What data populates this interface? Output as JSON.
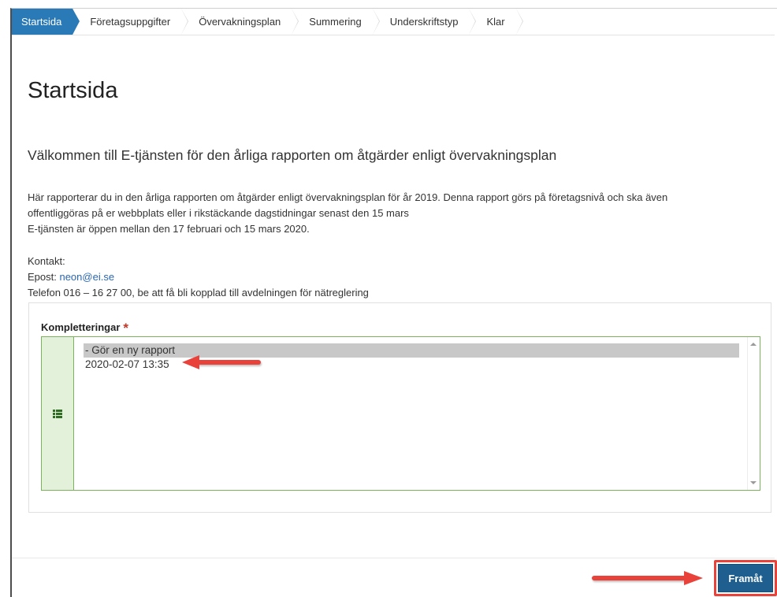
{
  "steps": [
    {
      "label": "Startsida",
      "active": true
    },
    {
      "label": "Företagsuppgifter",
      "active": false
    },
    {
      "label": "Övervakningsplan",
      "active": false
    },
    {
      "label": "Summering",
      "active": false
    },
    {
      "label": "Underskriftstyp",
      "active": false
    },
    {
      "label": "Klar",
      "active": false
    }
  ],
  "page": {
    "title": "Startsida",
    "subtitle": "Välkommen till E-tjänsten för den årliga rapporten om åtgärder enligt övervakningsplan",
    "paragraph_line1": "Här rapporterar du in den årliga rapporten om åtgärder enligt övervakningsplan för år 2019. Denna rapport görs på företagsnivå och ska även",
    "paragraph_line2": "offentliggöras på er webbplats eller i rikstäckande dagstidningar senast den 15 mars",
    "paragraph_line3": "E-tjänsten är öppen mellan den 17 februari och 15 mars 2020."
  },
  "contact": {
    "heading": "Kontakt:",
    "email_prefix": "Epost: ",
    "email": "neon@ei.se",
    "phone": "Telefon 016 – 16 27 00, be att få bli kopplad till avdelningen för nätreglering"
  },
  "completions": {
    "label": "Kompletteringar",
    "required_mark": "*",
    "options": [
      "- Gör en ny rapport",
      "2020-02-07 13:35"
    ],
    "selected_index": 0
  },
  "footer": {
    "next_label": "Framåt"
  },
  "colors": {
    "accent": "#2a7ab8",
    "annotation_arrow": "#e8423b",
    "primary_button": "#1f5f8f"
  }
}
